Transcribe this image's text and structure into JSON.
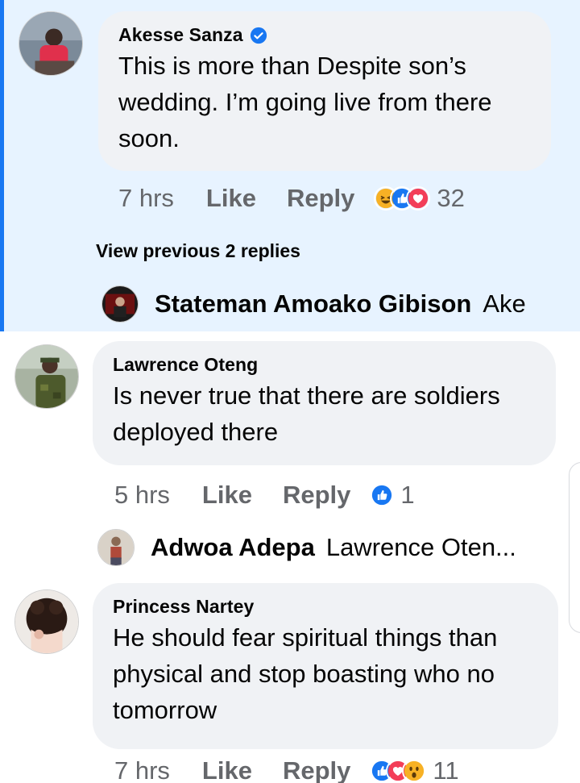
{
  "comments": [
    {
      "author": "Akesse Sanza",
      "verified": true,
      "text_lines": [
        "This is more than Despite son’s",
        "wedding. I’m going live from there",
        "soon."
      ],
      "time": "7 hrs",
      "like_label": "Like",
      "reply_label": "Reply",
      "reactions": [
        "haha-icon",
        "like-icon",
        "love-icon"
      ],
      "reaction_count": "32",
      "view_replies": "View previous 2 replies",
      "latest_reply": {
        "name": "Stateman Amoako Gibison",
        "snippet": "Ake"
      }
    },
    {
      "author": "Lawrence Oteng",
      "verified": false,
      "text_lines": [
        "Is never true that there are soldiers",
        "deployed there"
      ],
      "time": "5 hrs",
      "like_label": "Like",
      "reply_label": "Reply",
      "reactions": [
        "like-icon"
      ],
      "reaction_count": "1",
      "latest_reply": {
        "name": "Adwoa Adepa",
        "snippet": "Lawrence Oten..."
      }
    },
    {
      "author": "Princess Nartey",
      "verified": false,
      "text_lines": [
        "He should fear spiritual things than",
        "physical and stop boasting who no",
        "tomorrow"
      ],
      "time": "7 hrs",
      "like_label": "Like",
      "reply_label": "Reply",
      "reactions": [
        "like-icon",
        "love-icon",
        "wow-icon"
      ],
      "reaction_count": "11"
    }
  ],
  "colors": {
    "highlight_bg": "#e7f3ff",
    "highlight_bar": "#1877f2",
    "bubble_bg": "#f0f2f5",
    "meta_text": "#65676b",
    "like_blue": "#1877f2",
    "love_red": "#f33e58",
    "haha_yellow": "#f7b125"
  }
}
